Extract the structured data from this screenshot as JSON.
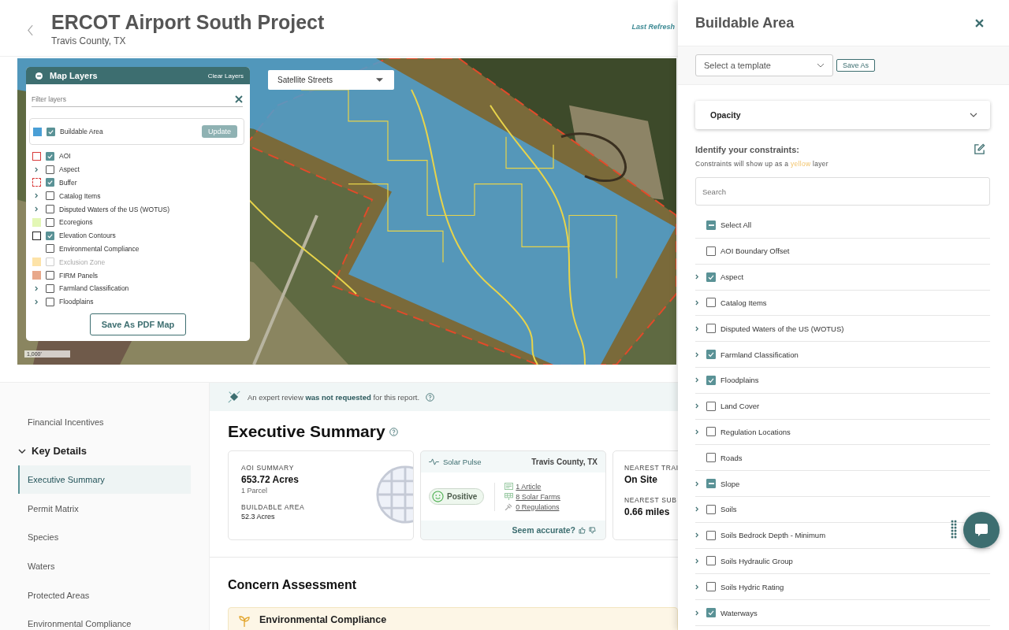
{
  "header": {
    "title": "ERCOT Airport South Project",
    "subtitle": "Travis County, TX",
    "last_refresh": "Last Refresh"
  },
  "map": {
    "basemap": "Satellite Streets",
    "scale": "1,000'",
    "layers_panel": {
      "title": "Map Layers",
      "clear": "Clear Layers",
      "filter_placeholder": "Filter layers",
      "buildable": {
        "label": "Buildable Area",
        "checked": true,
        "color": "#4a9fd6",
        "update": "Update"
      },
      "layers": [
        {
          "label": "AOI",
          "checked": true,
          "kind": "outline",
          "color": "#d93b3b",
          "disabled": false
        },
        {
          "label": "Aspect",
          "checked": false,
          "kind": "expandable",
          "disabled": false
        },
        {
          "label": "Buffer",
          "checked": true,
          "kind": "dashed",
          "color": "#d93b3b",
          "disabled": false
        },
        {
          "label": "Catalog Items",
          "checked": false,
          "kind": "expandable",
          "disabled": false
        },
        {
          "label": "Disputed Waters of the US (WOTUS)",
          "checked": false,
          "kind": "expandable",
          "disabled": false
        },
        {
          "label": "Ecoregions",
          "checked": false,
          "kind": "fill",
          "color": "#e3f7b5",
          "disabled": false
        },
        {
          "label": "Elevation Contours",
          "checked": true,
          "kind": "outline",
          "color": "#222222",
          "disabled": false
        },
        {
          "label": "Environmental Compliance",
          "checked": false,
          "kind": "plain",
          "disabled": false
        },
        {
          "label": "Exclusion Zone",
          "checked": false,
          "kind": "fill",
          "color": "#fde3a8",
          "disabled": true
        },
        {
          "label": "FIRM Panels",
          "checked": false,
          "kind": "fill",
          "color": "#e8a88a",
          "disabled": false
        },
        {
          "label": "Farmland Classification",
          "checked": false,
          "kind": "expandable",
          "disabled": false
        },
        {
          "label": "Floodplains",
          "checked": false,
          "kind": "expandable",
          "disabled": false
        }
      ],
      "save_button": "Save As PDF Map"
    }
  },
  "sidebar": {
    "items": [
      {
        "kind": "link",
        "label": "Financial Incentives",
        "selected": false
      },
      {
        "kind": "section",
        "label": "Key Details",
        "expanded": true,
        "children": [
          {
            "label": "Executive Summary",
            "selected": true
          },
          {
            "label": "Permit Matrix",
            "selected": false
          },
          {
            "label": "Species",
            "selected": false
          },
          {
            "label": "Waters",
            "selected": false
          },
          {
            "label": "Protected Areas",
            "selected": false
          },
          {
            "label": "Environmental Compliance",
            "selected": false
          }
        ]
      }
    ]
  },
  "main": {
    "expert_banner": "An expert review **was not requested** for this report.",
    "heading": "Executive Summary",
    "aoi_card": {
      "label": "AOI SUMMARY",
      "value": "653.72 Acres",
      "sub": "1 Parcel",
      "label_2": "BUILDABLE AREA",
      "value_2": "52.3 Acres"
    },
    "solar_pulse": {
      "title": "Solar Pulse",
      "location": "Travis County, TX",
      "sentiment": "Positive",
      "links": [
        {
          "kind": "article",
          "label": "1 Article"
        },
        {
          "kind": "farm",
          "label": "8 Solar Farms"
        },
        {
          "kind": "regulation",
          "label": "0 Regulations"
        }
      ],
      "feedback": "Seem accurate?"
    },
    "nearest_card": {
      "label": "NEAREST TRAI",
      "value": "On Site",
      "label_2": "NEAREST SUB",
      "value_2": "0.66 miles"
    },
    "concern_heading": "Concern Assessment",
    "concern_card": {
      "title": "Environmental Compliance"
    }
  },
  "panel": {
    "title": "Buildable Area",
    "template_placeholder": "Select a template",
    "save_as": "Save As",
    "opacity": {
      "label": "Opacity",
      "expanded": false
    },
    "constraints_heading": "Identify your constraints:",
    "note": {
      "before": "Constraints will show up as a ",
      "highlight": "yellow",
      "after": " layer"
    },
    "search_placeholder": "Search",
    "select_all": {
      "label": "Select All",
      "checked": true,
      "indeterminate": true
    },
    "constraints": [
      {
        "label": "AOI Boundary Offset",
        "checked": false,
        "indeterminate": false,
        "expandable": false
      },
      {
        "label": "Aspect",
        "checked": true,
        "indeterminate": false,
        "expandable": true
      },
      {
        "label": "Catalog Items",
        "checked": false,
        "indeterminate": false,
        "expandable": true
      },
      {
        "label": "Disputed Waters of the US (WOTUS)",
        "checked": false,
        "indeterminate": false,
        "expandable": true
      },
      {
        "label": "Farmland Classification",
        "checked": true,
        "indeterminate": false,
        "expandable": true
      },
      {
        "label": "Floodplains",
        "checked": true,
        "indeterminate": false,
        "expandable": true
      },
      {
        "label": "Land Cover",
        "checked": false,
        "indeterminate": false,
        "expandable": true
      },
      {
        "label": "Regulation Locations",
        "checked": false,
        "indeterminate": false,
        "expandable": true
      },
      {
        "label": "Roads",
        "checked": false,
        "indeterminate": false,
        "expandable": false
      },
      {
        "label": "Slope",
        "checked": true,
        "indeterminate": true,
        "expandable": true
      },
      {
        "label": "Soils",
        "checked": false,
        "indeterminate": false,
        "expandable": true
      },
      {
        "label": "Soils Bedrock Depth - Minimum",
        "checked": false,
        "indeterminate": false,
        "expandable": true
      },
      {
        "label": "Soils Hydraulic Group",
        "checked": false,
        "indeterminate": false,
        "expandable": true
      },
      {
        "label": "Soils Hydric Rating",
        "checked": false,
        "indeterminate": false,
        "expandable": true
      },
      {
        "label": "Waterways",
        "checked": true,
        "indeterminate": false,
        "expandable": true
      }
    ]
  }
}
